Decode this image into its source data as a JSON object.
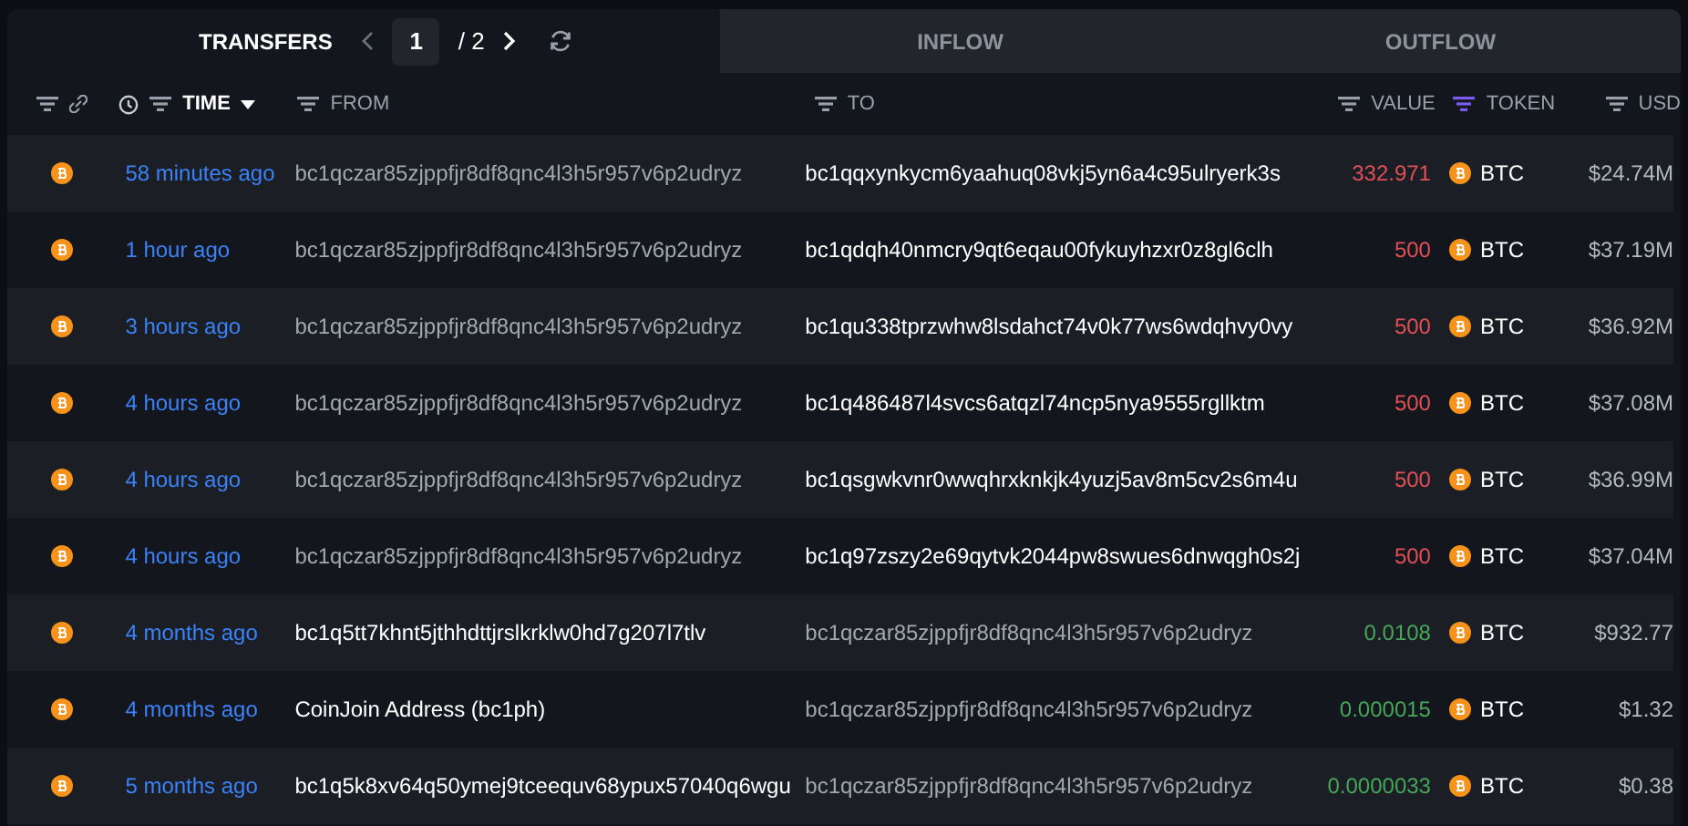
{
  "tabs": [
    {
      "label": "TRANSFERS",
      "selected": true
    },
    {
      "label": "INFLOW",
      "selected": false
    },
    {
      "label": "OUTFLOW",
      "selected": false
    }
  ],
  "pager": {
    "page": "1",
    "total": "/ 2"
  },
  "columns": [
    {
      "label": "TIME",
      "sorted": true,
      "filter_active": false
    },
    {
      "label": "FROM",
      "sorted": false,
      "filter_active": false
    },
    {
      "label": "TO",
      "sorted": false,
      "filter_active": false
    },
    {
      "label": "VALUE",
      "sorted": false,
      "filter_active": false
    },
    {
      "label": "TOKEN",
      "sorted": false,
      "filter_active": true
    },
    {
      "label": "USD",
      "sorted": false,
      "filter_active": false
    }
  ],
  "rows": [
    {
      "kind": "out",
      "time": "58 minutes ago",
      "from": "bc1qczar85zjppfjr8df8qnc4l3h5r957v6p2udryz",
      "to": "bc1qqxynkycm6yaahuq08vkj5yn6a4c95ulryerk3s",
      "value": "332.971",
      "token": "BTC",
      "usd": "$24.74M"
    },
    {
      "kind": "out",
      "time": "1 hour ago",
      "from": "bc1qczar85zjppfjr8df8qnc4l3h5r957v6p2udryz",
      "to": "bc1qdqh40nmcry9qt6eqau00fykuyhzxr0z8gl6clh",
      "value": "500",
      "token": "BTC",
      "usd": "$37.19M"
    },
    {
      "kind": "out",
      "time": "3 hours ago",
      "from": "bc1qczar85zjppfjr8df8qnc4l3h5r957v6p2udryz",
      "to": "bc1qu338tprzwhw8lsdahct74v0k77ws6wdqhvy0vy",
      "value": "500",
      "token": "BTC",
      "usd": "$36.92M"
    },
    {
      "kind": "out",
      "time": "4 hours ago",
      "from": "bc1qczar85zjppfjr8df8qnc4l3h5r957v6p2udryz",
      "to": "bc1q486487l4svcs6atqzl74ncp5nya9555rgllktm",
      "value": "500",
      "token": "BTC",
      "usd": "$37.08M"
    },
    {
      "kind": "out",
      "time": "4 hours ago",
      "from": "bc1qczar85zjppfjr8df8qnc4l3h5r957v6p2udryz",
      "to": "bc1qsgwkvnr0wwqhrxknkjk4yuzj5av8m5cv2s6m4u",
      "value": "500",
      "token": "BTC",
      "usd": "$36.99M"
    },
    {
      "kind": "out",
      "time": "4 hours ago",
      "from": "bc1qczar85zjppfjr8df8qnc4l3h5r957v6p2udryz",
      "to": "bc1q97zszy2e69qytvk2044pw8swues6dnwqgh0s2j",
      "value": "500",
      "token": "BTC",
      "usd": "$37.04M"
    },
    {
      "kind": "in",
      "time": "4 months ago",
      "from": "bc1q5tt7khnt5jthhdttjrslkrklw0hd7g207l7tlv",
      "to": "bc1qczar85zjppfjr8df8qnc4l3h5r957v6p2udryz",
      "value": "0.0108",
      "token": "BTC",
      "usd": "$932.77"
    },
    {
      "kind": "in",
      "time": "4 months ago",
      "from": "CoinJoin Address (bc1ph)",
      "to": "bc1qczar85zjppfjr8df8qnc4l3h5r957v6p2udryz",
      "value": "0.000015",
      "token": "BTC",
      "usd": "$1.32"
    },
    {
      "kind": "in",
      "time": "5 months ago",
      "from": "bc1q5k8xv64q50ymej9tceequv68ypux57040q6wgu",
      "to": "bc1qczar85zjppfjr8df8qnc4l3h5r957v6p2udryz",
      "value": "0.0000033",
      "token": "BTC",
      "usd": "$0.38"
    }
  ]
}
